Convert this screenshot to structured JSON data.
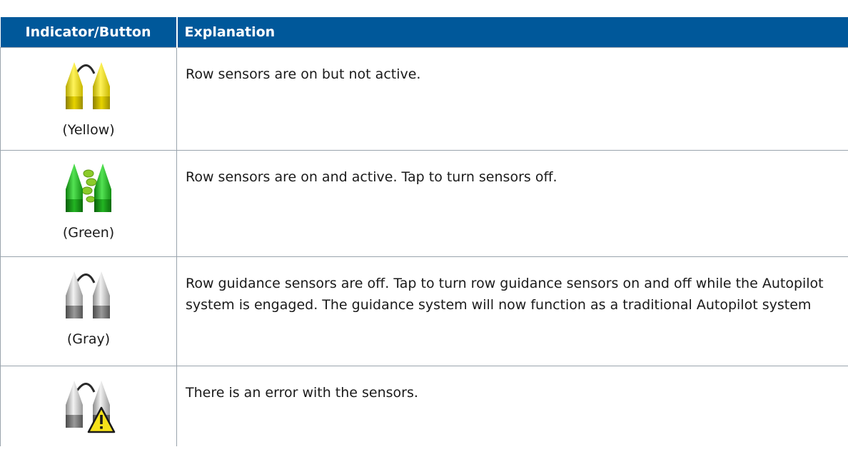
{
  "table": {
    "headers": {
      "indicator": "Indicator/Button",
      "explanation": "Explanation"
    },
    "rows": [
      {
        "icon": "row-sensors-yellow-icon",
        "color_label": "(Yellow)",
        "explanation": "Row sensors are on but not active."
      },
      {
        "icon": "row-sensors-green-icon",
        "color_label": "(Green)",
        "explanation": "Row sensors are on and active. Tap to turn sensors off."
      },
      {
        "icon": "row-sensors-gray-icon",
        "color_label": "(Gray)",
        "explanation": "Row guidance sensors are off. Tap to turn row guidance sensors on and off while the Autopilot system is engaged. The guidance system will now function as a traditional Autopilot system"
      },
      {
        "icon": "row-sensors-error-icon",
        "color_label": "",
        "explanation": "There is an error with the sensors."
      }
    ]
  },
  "colors": {
    "header_bg": "#00589a",
    "header_text": "#ffffff",
    "yellow": "#f3e417",
    "green": "#22b022",
    "gray": "#c8c8c8",
    "warning": "#f5e11a"
  }
}
